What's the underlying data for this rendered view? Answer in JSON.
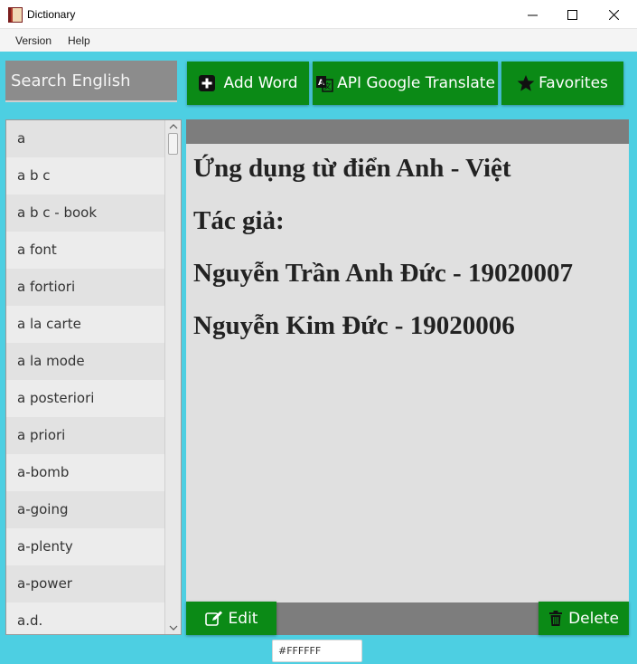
{
  "window": {
    "title": "Dictionary"
  },
  "menu": {
    "items": [
      "Version",
      "Help"
    ]
  },
  "search": {
    "placeholder": "Search English"
  },
  "toolbar": {
    "add_word": "Add Word",
    "translate": "API Google Translate",
    "favorites": "Favorites"
  },
  "word_list": [
    "a",
    "a b c",
    "a b c - book",
    "a font",
    "a fortiori",
    "a la carte",
    "a la mode",
    "a posteriori",
    "a priori",
    "a-bomb",
    "a-going",
    "a-plenty",
    "a-power",
    "a.d."
  ],
  "content": {
    "lines": [
      "Ứng dụng từ điển Anh - Việt",
      "Tác giả:",
      "Nguyễn Trần Anh Đức - 19020007",
      "Nguyễn Kim Đức - 19020006"
    ]
  },
  "actions": {
    "edit": "Edit",
    "delete": "Delete"
  },
  "color_picker": {
    "value": "#FFFFFF"
  },
  "colors": {
    "background": "#4dcfe2",
    "button": "#0b8a16",
    "panel": "#e0e0e0",
    "panel_bar": "#7d7d7d"
  },
  "icons": {
    "add": "plus-square-icon",
    "translate": "translate-icon",
    "favorites": "star-icon",
    "edit": "edit-icon",
    "delete": "trash-icon"
  }
}
